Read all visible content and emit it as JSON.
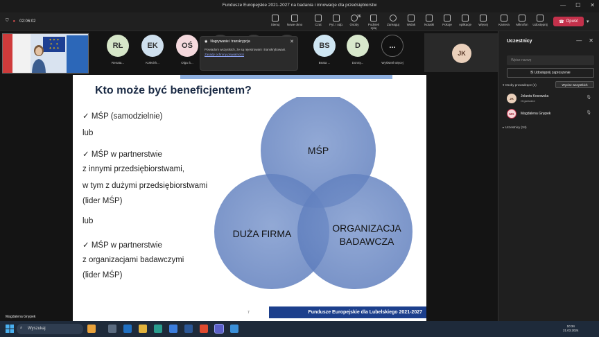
{
  "window": {
    "title": "Fundusze Europejskie 2021-2027 na badania i innowacje dla przedsiębiorstw"
  },
  "toolbar": {
    "timer": "02:06:02",
    "tools": [
      {
        "label": "Stenuj",
        "icon": "stage-icon"
      },
      {
        "label": "Nowe okno",
        "icon": "window-icon"
      },
      {
        "label": "Czat",
        "icon": "chat-icon"
      },
      {
        "label": "Pyt. i odp.",
        "icon": "qa-icon"
      },
      {
        "label": "Osoby",
        "icon": "people-icon",
        "badge": "36"
      },
      {
        "label": "Podnieś rękę",
        "icon": "hand-icon"
      },
      {
        "label": "Zareaguj",
        "icon": "react-icon"
      },
      {
        "label": "Widok",
        "icon": "view-icon"
      },
      {
        "label": "Notatki",
        "icon": "notes-icon"
      },
      {
        "label": "Pokoje",
        "icon": "rooms-icon"
      },
      {
        "label": "Aplikacje",
        "icon": "apps-icon"
      },
      {
        "label": "Więcej",
        "icon": "more-icon"
      },
      {
        "label": "Kamera",
        "icon": "camera-icon"
      },
      {
        "label": "Mikrofon",
        "icon": "mic-icon"
      },
      {
        "label": "Udostępnij",
        "icon": "share-icon"
      }
    ],
    "leave_label": "Opuść"
  },
  "participants": [
    {
      "initials": "RŁ",
      "name": "Renata...",
      "bg": "#d6e6c8"
    },
    {
      "initials": "EK",
      "name": "Kołeckh...",
      "bg": "#cfe0ee"
    },
    {
      "initials": "OŚ",
      "name": "Olga Ś...",
      "bg": "#f5d9dd"
    },
    {
      "initials": "",
      "name": "Anna...",
      "bg": "#3a3a3a"
    },
    {
      "initials": "",
      "name": "Agnies...",
      "bg": "#3a3a3a"
    },
    {
      "initials": "",
      "name": "Elżbiet...",
      "bg": "#3a3a3a"
    },
    {
      "initials": "BS",
      "name": "Beata ...",
      "bg": "#cfe6f3"
    },
    {
      "initials": "D",
      "name": "Doroty...",
      "bg": "#d8e8cc"
    },
    {
      "initials": "...",
      "name": "Wyświetl więcej",
      "bg": "#111111"
    }
  ],
  "notification": {
    "title": "Nagrywanie i transkrypcja",
    "body": "Powiadom wszystkich, że są rejestrowani i transkrybowani.",
    "link": "Zasady ochrony prywatności"
  },
  "jk_tile": {
    "initials": "JK"
  },
  "slide": {
    "title": "Kto może być beneficjentem?",
    "items": [
      "✓  MŚP (samodzielnie)",
      "lub",
      "✓  MŚP w partnerstwie",
      "z innymi przedsiębiorstwami,",
      "w tym z dużymi przedsiębiorstwami",
      "(lider MŚP)",
      "lub",
      "✓  MŚP w partnerstwie",
      "z organizacjami badawczymi",
      "(lider MŚP)"
    ],
    "venn": {
      "top": "MŚP",
      "left": "DUŻA FIRMA",
      "right_line1": "ORGANIZACJA",
      "right_line2": "BADAWCZA"
    },
    "page_number": "7",
    "footer": "Fundusze Europejskie dla Lubelskiego 2021-2027"
  },
  "speaker_name": "Magdalena Gnypek",
  "panel": {
    "title": "Uczestnicy",
    "search_placeholder": "Wpisz nazwę",
    "share_invite": "Udostępnij zaproszenie",
    "organizers_label": "Osoby prowadzące (2)",
    "mute_all": "Wycisz wszystkich",
    "people": [
      {
        "initials": "JK",
        "name": "Jolanta Kosowska",
        "role": "Organizator",
        "bg": "#ead0bb"
      },
      {
        "initials": "MG",
        "name": "Magdalena Gnypek",
        "role": "",
        "bg": "#f6d6d9"
      }
    ],
    "attendees_label": "Uczestnicy (34)"
  },
  "taskbar": {
    "search": "Wyszukaj",
    "time": "10:34",
    "date": "21.03.2024"
  }
}
